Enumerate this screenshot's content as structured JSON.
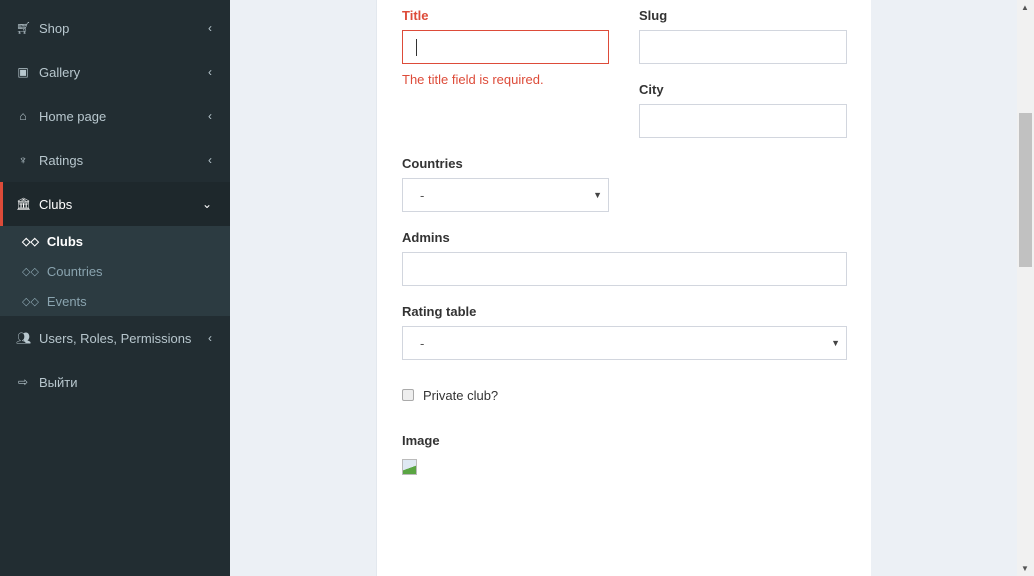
{
  "sidebar": {
    "items": [
      {
        "label": "Shop",
        "icon": "cart-icon"
      },
      {
        "label": "Gallery",
        "icon": "image-icon"
      },
      {
        "label": "Home page",
        "icon": "home-icon"
      },
      {
        "label": "Ratings",
        "icon": "trophy-icon"
      },
      {
        "label": "Clubs",
        "icon": "institution-icon"
      },
      {
        "label": "Users, Roles, Permissions",
        "icon": "users-icon"
      },
      {
        "label": "Выйти",
        "icon": "sign-out-icon"
      }
    ],
    "submenu": [
      {
        "label": "Clubs"
      },
      {
        "label": "Countries"
      },
      {
        "label": "Events"
      }
    ]
  },
  "form": {
    "title_label": "Title",
    "title_value": "",
    "title_error": "The title field is required.",
    "slug_label": "Slug",
    "slug_value": "",
    "city_label": "City",
    "city_value": "",
    "countries_label": "Countries",
    "countries_value": "-",
    "admins_label": "Admins",
    "admins_value": "",
    "rating_label": "Rating table",
    "rating_value": "-",
    "private_label": "Private club?",
    "private_checked": false,
    "image_label": "Image"
  },
  "colors": {
    "sidebar": "#222d32",
    "accent": "#dd4b39",
    "error": "#dd4b39",
    "background": "#ecf0f5"
  }
}
